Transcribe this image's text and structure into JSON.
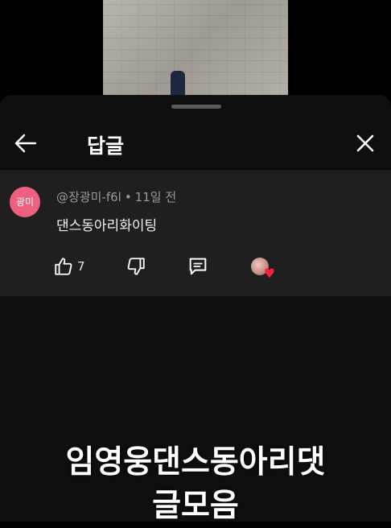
{
  "header": {
    "title": "답글"
  },
  "comment": {
    "avatar_text": "광미",
    "author": "@장광미-f6l",
    "time": "11일 전",
    "text": "댄스동아리화이팅",
    "like_count": "7"
  },
  "caption": {
    "line1": "임영웅댄스동아리댓",
    "line2": "글모음"
  },
  "colors": {
    "avatar_bg": "#ef5f7e",
    "sheet_bg": "#0f0f0f",
    "comment_bg": "#1f1f1f",
    "heart": "#ff1f3d"
  }
}
